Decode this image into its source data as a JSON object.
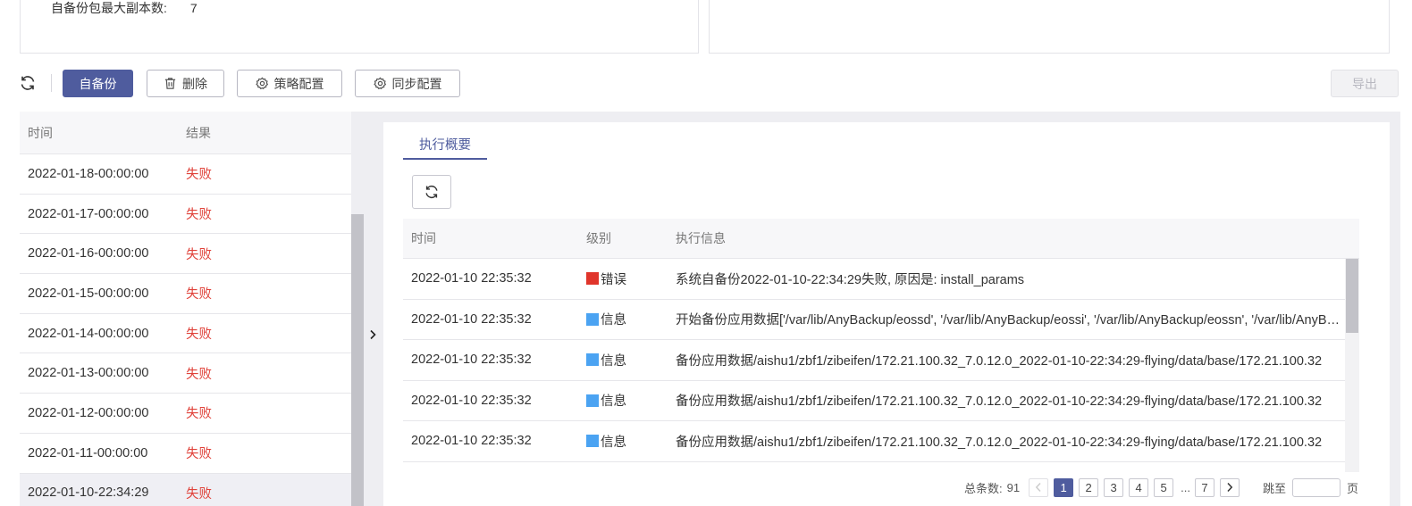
{
  "summary": {
    "max_copies_label": "自备份包最大副本数:",
    "max_copies_value": "7"
  },
  "toolbar": {
    "self_backup": "自备份",
    "delete": "删除",
    "policy_config": "策略配置",
    "sync_config": "同步配置",
    "export": "导出"
  },
  "history": {
    "col_time": "时间",
    "col_result": "结果",
    "rows": [
      {
        "time": "2022-01-18-00:00:00",
        "result": "失败"
      },
      {
        "time": "2022-01-17-00:00:00",
        "result": "失败"
      },
      {
        "time": "2022-01-16-00:00:00",
        "result": "失败"
      },
      {
        "time": "2022-01-15-00:00:00",
        "result": "失败"
      },
      {
        "time": "2022-01-14-00:00:00",
        "result": "失败"
      },
      {
        "time": "2022-01-13-00:00:00",
        "result": "失败"
      },
      {
        "time": "2022-01-12-00:00:00",
        "result": "失败"
      },
      {
        "time": "2022-01-11-00:00:00",
        "result": "失败"
      },
      {
        "time": "2022-01-10-22:34:29",
        "result": "失败"
      }
    ]
  },
  "detail": {
    "tab": "执行概要",
    "col_time": "时间",
    "col_level": "级别",
    "col_info": "执行信息",
    "level_colors": {
      "error": "#e0352b",
      "info": "#4ba3f2"
    },
    "rows": [
      {
        "time": "2022-01-10 22:35:32",
        "level": "错误",
        "level_type": "error",
        "info": "系统自备份2022-01-10-22:34:29失败, 原因是: install_params"
      },
      {
        "time": "2022-01-10 22:35:32",
        "level": "信息",
        "level_type": "info",
        "info": "开始备份应用数据['/var/lib/AnyBackup/eossd', '/var/lib/AnyBackup/eossi', '/var/lib/AnyBackup/eossn', '/var/lib/AnyBackup/eossm']"
      },
      {
        "time": "2022-01-10 22:35:32",
        "level": "信息",
        "level_type": "info",
        "info": "备份应用数据/aishu1/zbf1/zibeifen/172.21.100.32_7.0.12.0_2022-01-10-22:34:29-flying/data/base/172.21.100.32"
      },
      {
        "time": "2022-01-10 22:35:32",
        "level": "信息",
        "level_type": "info",
        "info": "备份应用数据/aishu1/zbf1/zibeifen/172.21.100.32_7.0.12.0_2022-01-10-22:34:29-flying/data/base/172.21.100.32"
      },
      {
        "time": "2022-01-10 22:35:32",
        "level": "信息",
        "level_type": "info",
        "info": "备份应用数据/aishu1/zbf1/zibeifen/172.21.100.32_7.0.12.0_2022-01-10-22:34:29-flying/data/base/172.21.100.32"
      }
    ]
  },
  "pagination": {
    "total_label": "总条数:",
    "total": "91",
    "pages": [
      "1",
      "2",
      "3",
      "4",
      "5"
    ],
    "ellipsis": "...",
    "last_page": "7",
    "jump_label": "跳至",
    "page_suffix": "页"
  }
}
